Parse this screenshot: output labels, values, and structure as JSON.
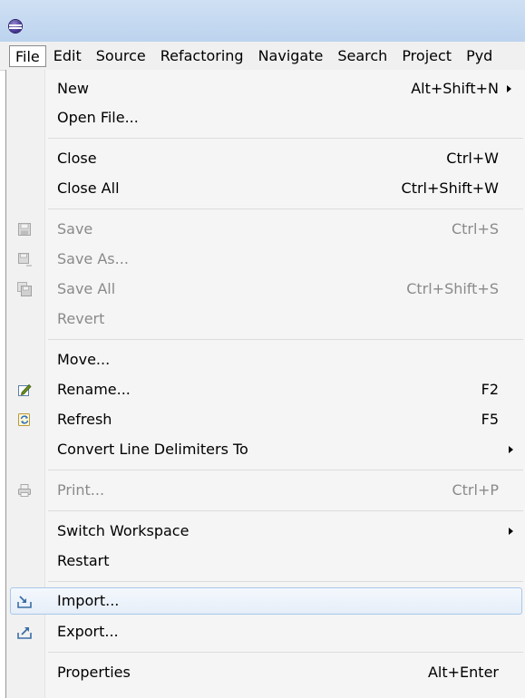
{
  "menubar": {
    "items": [
      "File",
      "Edit",
      "Source",
      "Refactoring",
      "Navigate",
      "Search",
      "Project",
      "Pyd"
    ]
  },
  "file_menu": {
    "new": {
      "label": "New",
      "accel": "Alt+Shift+N"
    },
    "open_file": {
      "label": "Open File..."
    },
    "close": {
      "label": "Close",
      "accel": "Ctrl+W"
    },
    "close_all": {
      "label": "Close All",
      "accel": "Ctrl+Shift+W"
    },
    "save": {
      "label": "Save",
      "accel": "Ctrl+S"
    },
    "save_as": {
      "label": "Save As..."
    },
    "save_all": {
      "label": "Save All",
      "accel": "Ctrl+Shift+S"
    },
    "revert": {
      "label": "Revert"
    },
    "move": {
      "label": "Move..."
    },
    "rename": {
      "label": "Rename...",
      "accel": "F2"
    },
    "refresh": {
      "label": "Refresh",
      "accel": "F5"
    },
    "convert": {
      "label": "Convert Line Delimiters To"
    },
    "print": {
      "label": "Print...",
      "accel": "Ctrl+P"
    },
    "switch_workspace": {
      "label": "Switch Workspace"
    },
    "restart": {
      "label": "Restart"
    },
    "import": {
      "label": "Import..."
    },
    "export": {
      "label": "Export..."
    },
    "properties": {
      "label": "Properties",
      "accel": "Alt+Enter"
    }
  },
  "icons": {
    "app": "eclipse-icon",
    "save": "save-icon",
    "save_as": "save-as-icon",
    "save_all": "save-all-icon",
    "rename": "rename-icon",
    "refresh": "refresh-icon",
    "print": "print-icon",
    "import": "import-icon",
    "export": "export-icon"
  }
}
